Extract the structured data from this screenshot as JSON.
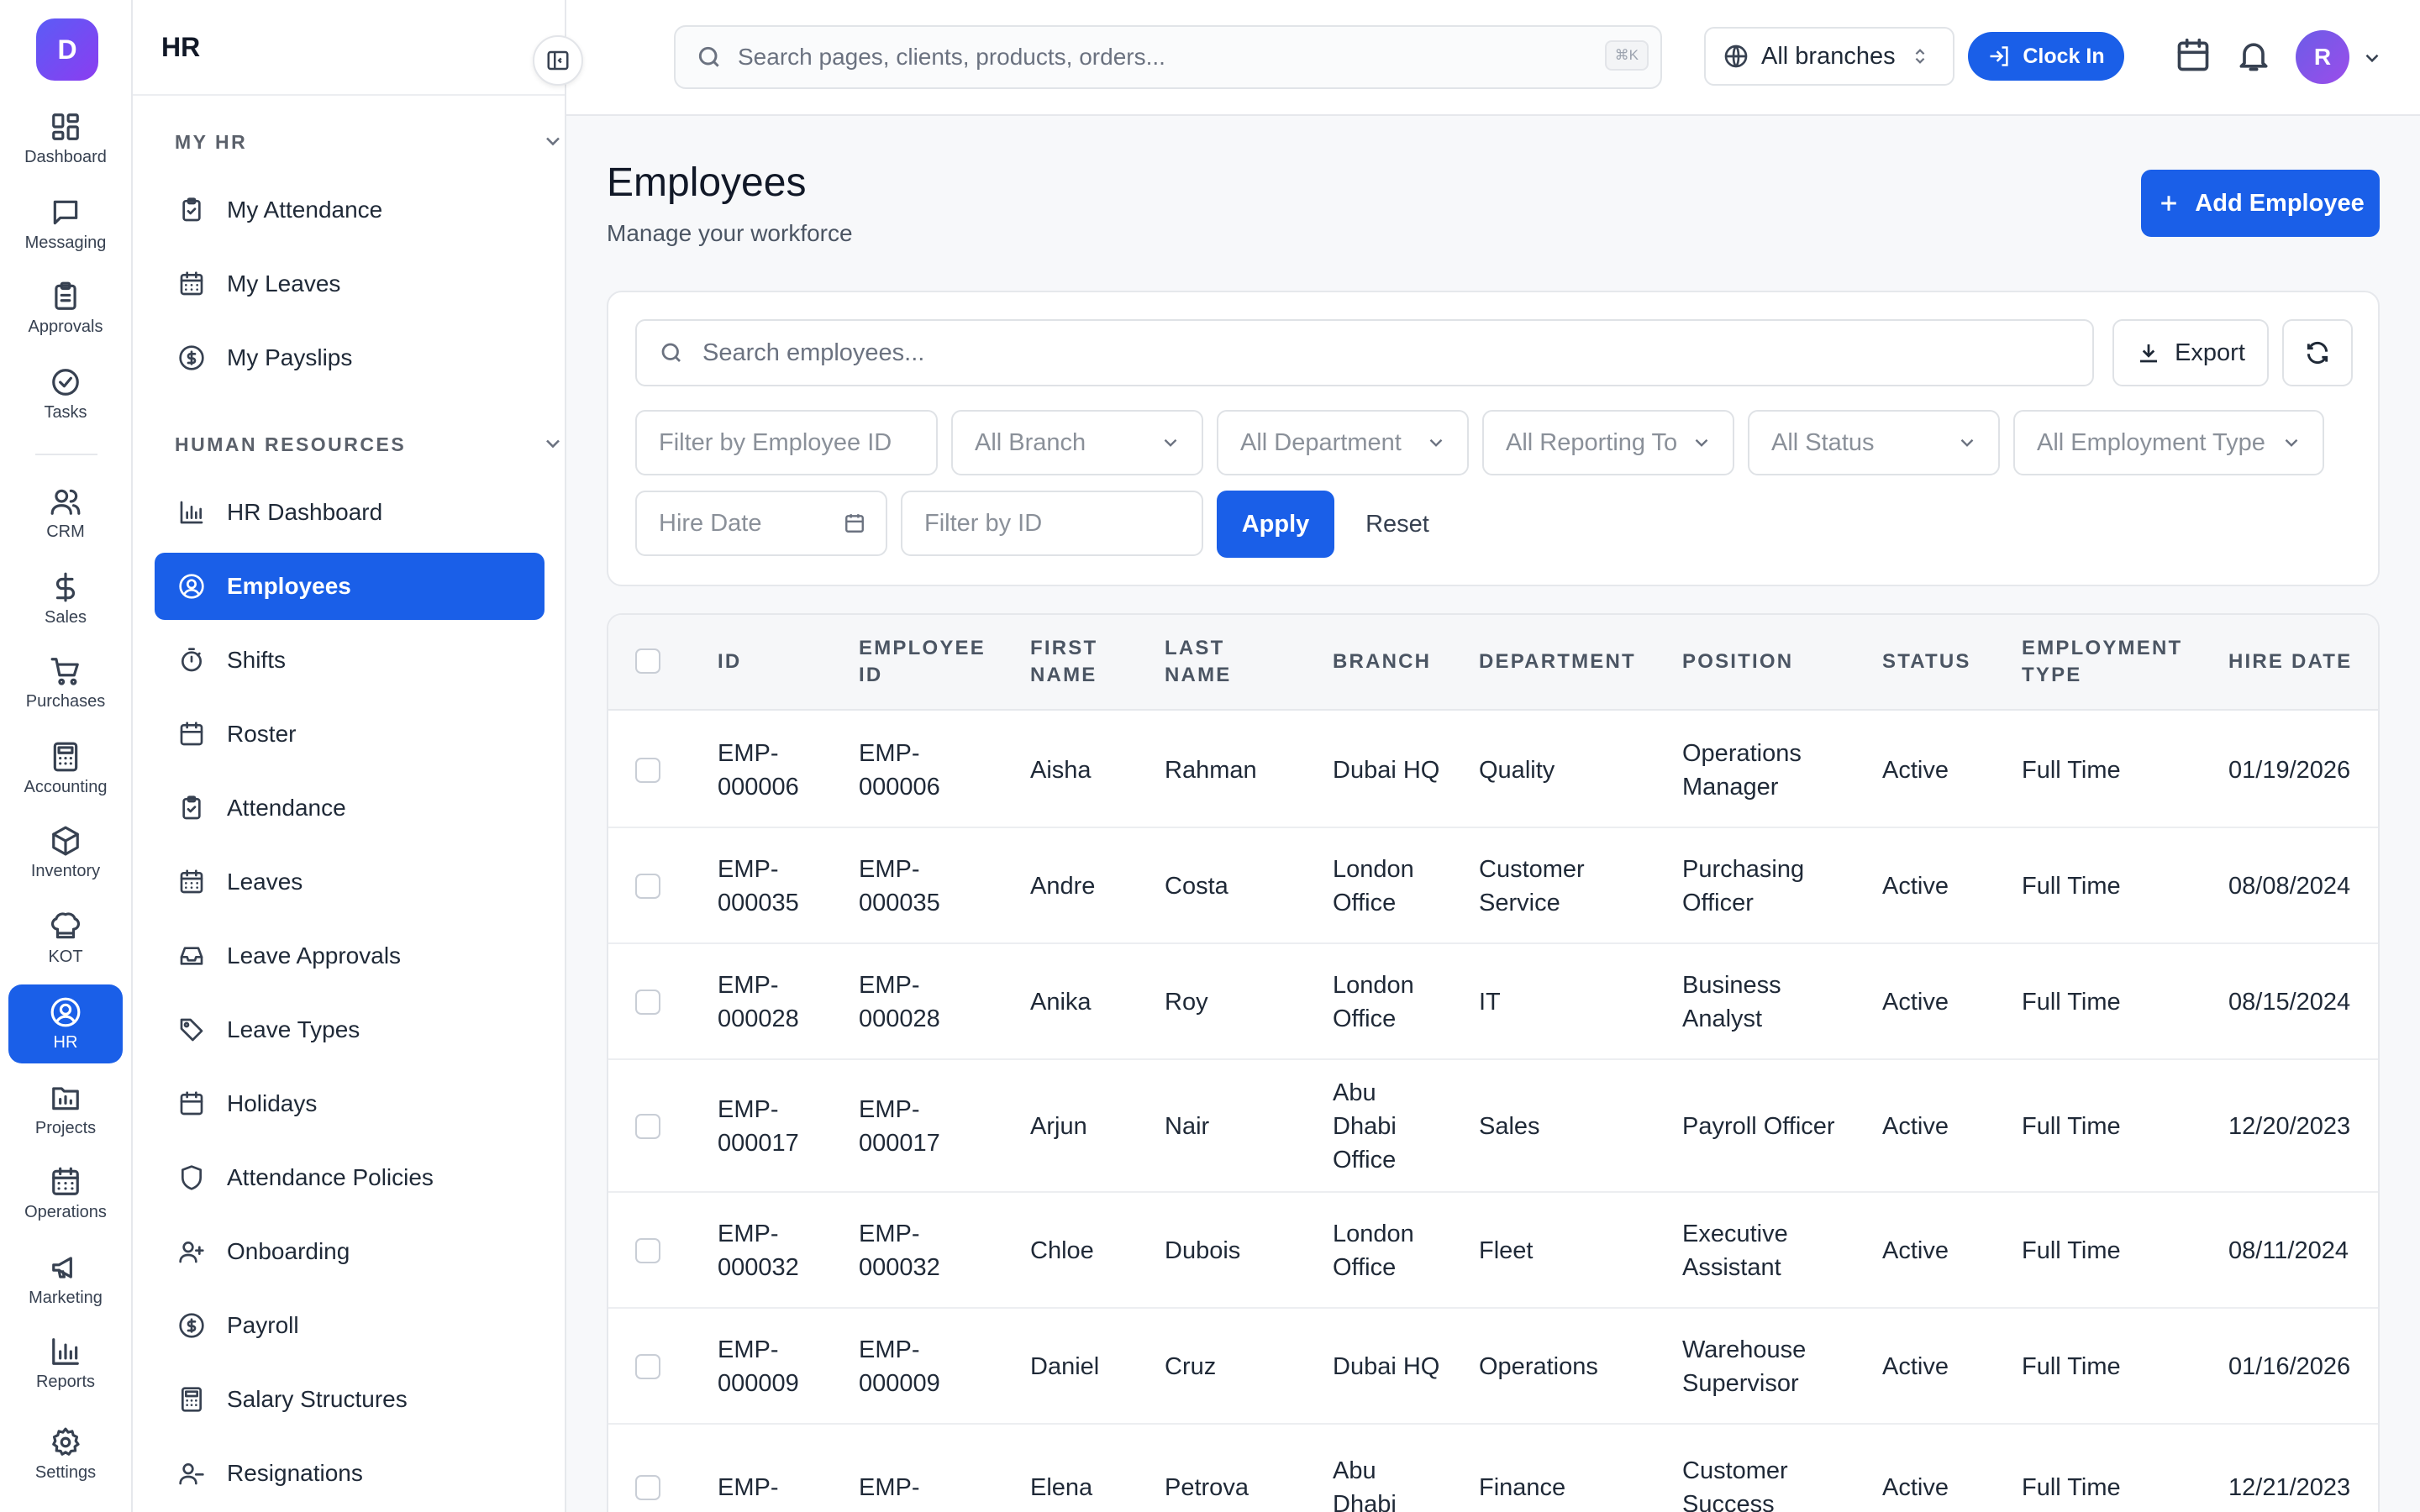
{
  "rail": {
    "logo_letter": "D",
    "items": [
      {
        "label": "Dashboard",
        "icon": "dashboard-icon"
      },
      {
        "label": "Messaging",
        "icon": "messaging-icon"
      },
      {
        "label": "Approvals",
        "icon": "approvals-icon"
      },
      {
        "label": "Tasks",
        "icon": "tasks-icon"
      },
      {
        "label": "CRM",
        "icon": "crm-icon"
      },
      {
        "label": "Sales",
        "icon": "sales-icon"
      },
      {
        "label": "Purchases",
        "icon": "cart-icon"
      },
      {
        "label": "Accounting",
        "icon": "calculator-icon"
      },
      {
        "label": "Inventory",
        "icon": "box-icon"
      },
      {
        "label": "KOT",
        "icon": "chef-hat-icon"
      },
      {
        "label": "HR",
        "icon": "user-circle-icon",
        "active": true
      },
      {
        "label": "Projects",
        "icon": "folder-chart-icon"
      },
      {
        "label": "Operations",
        "icon": "calendar-grid-icon"
      },
      {
        "label": "Marketing",
        "icon": "megaphone-icon"
      },
      {
        "label": "Reports",
        "icon": "bar-chart-icon"
      },
      {
        "label": "Settings",
        "icon": "gear-icon"
      }
    ]
  },
  "sidebar": {
    "title": "HR",
    "sections": [
      {
        "heading": "MY HR",
        "items": [
          {
            "label": "My Attendance",
            "icon": "clipboard-check-icon"
          },
          {
            "label": "My Leaves",
            "icon": "calendar-icon"
          },
          {
            "label": "My Payslips",
            "icon": "dollar-circle-icon"
          }
        ]
      },
      {
        "heading": "HUMAN RESOURCES",
        "items": [
          {
            "label": "HR Dashboard",
            "icon": "bar-chart-icon"
          },
          {
            "label": "Employees",
            "icon": "user-circle-icon",
            "active": true
          },
          {
            "label": "Shifts",
            "icon": "timer-icon"
          },
          {
            "label": "Roster",
            "icon": "calendar-icon"
          },
          {
            "label": "Attendance",
            "icon": "clipboard-check-icon"
          },
          {
            "label": "Leaves",
            "icon": "calendar-grid-icon"
          },
          {
            "label": "Leave Approvals",
            "icon": "inbox-icon"
          },
          {
            "label": "Leave Types",
            "icon": "tag-icon"
          },
          {
            "label": "Holidays",
            "icon": "calendar-icon"
          },
          {
            "label": "Attendance Policies",
            "icon": "shield-icon"
          },
          {
            "label": "Onboarding",
            "icon": "user-plus-icon"
          },
          {
            "label": "Payroll",
            "icon": "dollar-circle-icon"
          },
          {
            "label": "Salary Structures",
            "icon": "calculator-icon"
          },
          {
            "label": "Resignations",
            "icon": "user-minus-icon"
          }
        ]
      }
    ]
  },
  "topbar": {
    "search_placeholder": "Search pages, clients, products, orders...",
    "shortcut": "⌘K",
    "branch": "All branches",
    "clock_in": "Clock In",
    "avatar_letter": "R"
  },
  "page": {
    "title": "Employees",
    "subtitle": "Manage your workforce",
    "add_button": "Add Employee"
  },
  "filters": {
    "search_placeholder": "Search employees...",
    "export": "Export",
    "employee_id_placeholder": "Filter by Employee ID",
    "branch": "All Branch",
    "department": "All Department",
    "reporting_to": "All Reporting To",
    "status": "All Status",
    "employment_type": "All Employment Type",
    "hire_date": "Hire Date",
    "id_placeholder": "Filter by ID",
    "apply": "Apply",
    "reset": "Reset"
  },
  "table": {
    "headers": [
      "ID",
      "EMPLOYEE ID",
      "FIRST NAME",
      "LAST NAME",
      "BRANCH",
      "DEPARTMENT",
      "POSITION",
      "STATUS",
      "EMPLOYMENT TYPE",
      "HIRE DATE"
    ],
    "rows": [
      {
        "id": "EMP-000006",
        "employee_id": "EMP-000006",
        "first": "Aisha",
        "last": "Rahman",
        "branch": "Dubai HQ",
        "department": "Quality",
        "position": "Operations Manager",
        "status": "Active",
        "type": "Full Time",
        "hire": "01/19/2026"
      },
      {
        "id": "EMP-000035",
        "employee_id": "EMP-000035",
        "first": "Andre",
        "last": "Costa",
        "branch": "London Office",
        "department": "Customer Service",
        "position": "Purchasing Officer",
        "status": "Active",
        "type": "Full Time",
        "hire": "08/08/2024"
      },
      {
        "id": "EMP-000028",
        "employee_id": "EMP-000028",
        "first": "Anika",
        "last": "Roy",
        "branch": "London Office",
        "department": "IT",
        "position": "Business Analyst",
        "status": "Active",
        "type": "Full Time",
        "hire": "08/15/2024"
      },
      {
        "id": "EMP-000017",
        "employee_id": "EMP-000017",
        "first": "Arjun",
        "last": "Nair",
        "branch": "Abu Dhabi Office",
        "department": "Sales",
        "position": "Payroll Officer",
        "status": "Active",
        "type": "Full Time",
        "hire": "12/20/2023"
      },
      {
        "id": "EMP-000032",
        "employee_id": "EMP-000032",
        "first": "Chloe",
        "last": "Dubois",
        "branch": "London Office",
        "department": "Fleet",
        "position": "Executive Assistant",
        "status": "Active",
        "type": "Full Time",
        "hire": "08/11/2024"
      },
      {
        "id": "EMP-000009",
        "employee_id": "EMP-000009",
        "first": "Daniel",
        "last": "Cruz",
        "branch": "Dubai HQ",
        "department": "Operations",
        "position": "Warehouse Supervisor",
        "status": "Active",
        "type": "Full Time",
        "hire": "01/16/2026"
      },
      {
        "id": "EMP-",
        "employee_id": "EMP-",
        "first": "Elena",
        "last": "Petrova",
        "branch": "Abu Dhabi",
        "department": "Finance",
        "position": "Customer Success",
        "status": "Active",
        "type": "Full Time",
        "hire": "12/21/2023"
      }
    ]
  },
  "colors": {
    "accent": "#1a5fe8",
    "logo_gradient_start": "#5b5cf6",
    "logo_gradient_end": "#8b3df0"
  }
}
